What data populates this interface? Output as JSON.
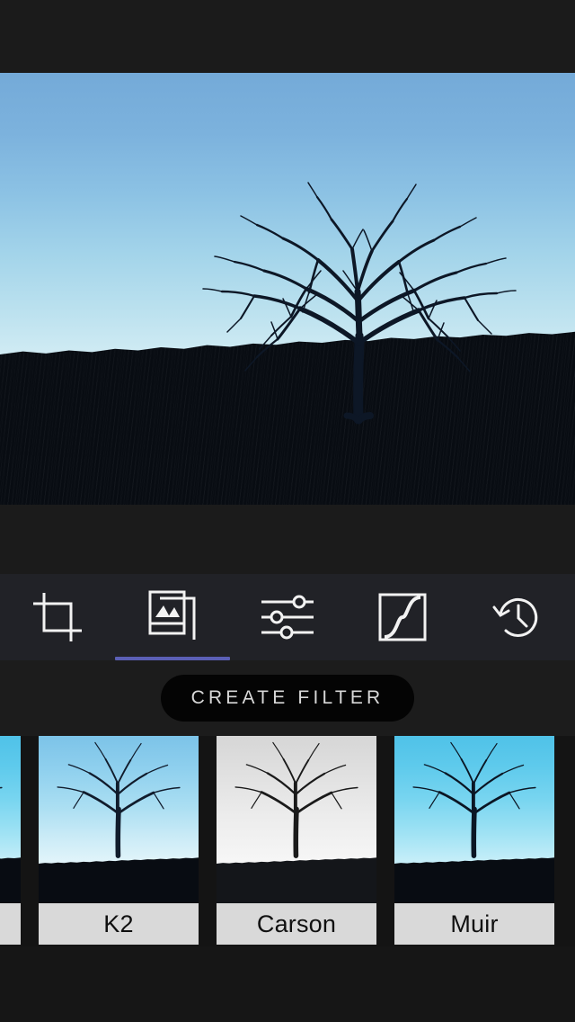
{
  "app": {
    "name": "photo-filter-editor",
    "theme_background": "#1b1b1b",
    "accent_color": "#5b5fb5"
  },
  "statusbar": {
    "content": ""
  },
  "photo": {
    "subject": "bare-tree-on-hill",
    "sky_top_color": "#74aad8",
    "sky_bottom_color": "#ffffff",
    "ground_color": "#080c12"
  },
  "toolbar": {
    "tabs": [
      {
        "id": "crop",
        "icon": "crop-icon",
        "label": "Crop",
        "active": false
      },
      {
        "id": "filters",
        "icon": "photo-stack-icon",
        "label": "Filters",
        "active": true
      },
      {
        "id": "adjust",
        "icon": "sliders-icon",
        "label": "Adjust",
        "active": false
      },
      {
        "id": "curves",
        "icon": "tone-curve-icon",
        "label": "Curves",
        "active": false
      },
      {
        "id": "history",
        "icon": "history-clock-icon",
        "label": "History",
        "active": false
      }
    ],
    "active_index": 1,
    "underline_color": "#5b5fb5"
  },
  "create_filter": {
    "label": "CREATE FILTER",
    "background": "#040404",
    "text_color": "#d8d8d8"
  },
  "filter_strip": {
    "label_background": "#d9d9d9",
    "label_text_color": "#101010",
    "thumbnails": [
      {
        "id": "partial-left",
        "name": "",
        "style": "vivid",
        "partially_visible": true
      },
      {
        "id": "k2",
        "name": "K2",
        "style": "normal",
        "partially_visible": false
      },
      {
        "id": "carson",
        "name": "Carson",
        "style": "mono",
        "partially_visible": false
      },
      {
        "id": "muir",
        "name": "Muir",
        "style": "vivid",
        "partially_visible": false
      }
    ]
  }
}
